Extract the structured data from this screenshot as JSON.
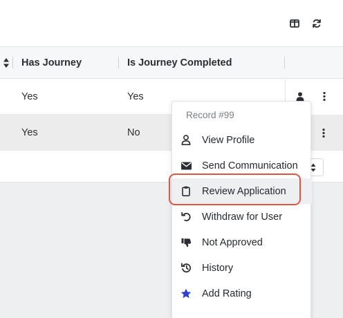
{
  "toolbar": {
    "columns_icon": "columns-icon",
    "refresh_icon": "refresh-icon"
  },
  "table": {
    "headers": [
      "Has Journey",
      "Is Journey Completed"
    ],
    "rows": [
      {
        "has_journey": "Yes",
        "is_journey_completed": "Yes"
      },
      {
        "has_journey": "Yes",
        "is_journey_completed": "No"
      }
    ]
  },
  "context_menu": {
    "header": "Record #99",
    "items": [
      {
        "label": "View Profile",
        "icon": "user-outline-icon"
      },
      {
        "label": "Send Communication",
        "icon": "envelope-icon"
      },
      {
        "label": "Review Application",
        "icon": "clipboard-icon"
      },
      {
        "label": "Withdraw for User",
        "icon": "undo-icon"
      },
      {
        "label": "Not Approved",
        "icon": "thumbs-down-icon"
      },
      {
        "label": "History",
        "icon": "history-icon"
      },
      {
        "label": "Add Rating",
        "icon": "star-icon"
      }
    ]
  },
  "colors": {
    "highlight_ring": "#e0553f",
    "star": "#2f3fcf",
    "icon": "#2b2f33"
  }
}
